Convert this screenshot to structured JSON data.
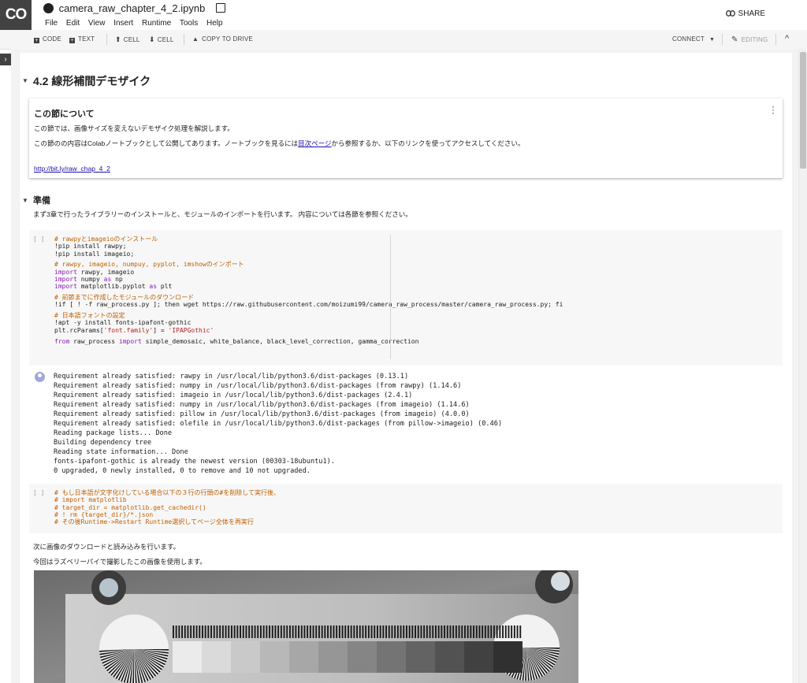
{
  "header": {
    "logo_text": "CO",
    "notebook_title": "camera_raw_chapter_4_2.ipynb",
    "menu": [
      "File",
      "Edit",
      "View",
      "Insert",
      "Runtime",
      "Tools",
      "Help"
    ],
    "share_label": "SHARE"
  },
  "toolbar": {
    "code_label": "CODE",
    "text_label": "TEXT",
    "cell_up_label": "CELL",
    "cell_down_label": "CELL",
    "copy_label": "COPY TO DRIVE",
    "connect_label": "CONNECT",
    "editing_label": "EDITING"
  },
  "section": {
    "heading": "4.2 線形補間デモザイク",
    "about": {
      "heading": "この節について",
      "p1": "この節では、画像サイズを変えないデモザイク処理を解説します。",
      "p2_before": "この節のの内容はColabノートブックとして公開してあります。ノートブックを見るには",
      "p2_link": "目次ページ",
      "p2_after": "から参照するか、以下のリンクを使ってアクセスしてください。",
      "url": "http://bit.ly/raw_chap_4_2"
    }
  },
  "prep": {
    "heading": "準備",
    "desc": "まず3章で行ったライブラリーのインストールと、モジュールのインポートを行います。 内容については各節を参照ください。"
  },
  "cell1": {
    "run_label": "[ ]",
    "lines": {
      "c1": "# rawpyとimageioのインストール",
      "l2": "!pip install rawpy;",
      "l3": "!pip install imageio;",
      "c4": "# rawpy, imageio, numpuy, pyplot, imshowのインポート",
      "l5_kw": "import",
      "l5_rest": " rawpy, imageio",
      "l6_kw": "import",
      "l6_mid": " numpy ",
      "l6_as": "as",
      "l6_rest": " np",
      "l7_kw": "import",
      "l7_mid": " matplotlib.pyplot ",
      "l7_as": "as",
      "l7_rest": " plt",
      "c8": "# 前節までに作成したモジュールのダウンロード",
      "l9": "!if [ ! -f raw_process.py ]; then wget https://raw.githubusercontent.com/moizumi99/camera_raw_process/master/camera_raw_process.py; fi",
      "c10": "# 日本語フォントの設定",
      "l11": "!apt -y install fonts-ipafont-gothic",
      "l12_a": "plt.rcParams[",
      "l12_s1": "'font.family'",
      "l12_b": "] = ",
      "l12_s2": "'IPAPGothic'",
      "l13_kw1": "from",
      "l13_mid": " raw_process ",
      "l13_kw2": "import",
      "l13_rest": " simple_demosaic, white_balance, black_level_correction, gamma_correction"
    }
  },
  "output": [
    "Requirement already satisfied: rawpy in /usr/local/lib/python3.6/dist-packages (0.13.1)",
    "Requirement already satisfied: numpy in /usr/local/lib/python3.6/dist-packages (from rawpy) (1.14.6)",
    "Requirement already satisfied: imageio in /usr/local/lib/python3.6/dist-packages (2.4.1)",
    "Requirement already satisfied: numpy in /usr/local/lib/python3.6/dist-packages (from imageio) (1.14.6)",
    "Requirement already satisfied: pillow in /usr/local/lib/python3.6/dist-packages (from imageio) (4.0.0)",
    "Requirement already satisfied: olefile in /usr/local/lib/python3.6/dist-packages (from pillow->imageio) (0.46)",
    "Reading package lists... Done",
    "Building dependency tree",
    "Reading state information... Done",
    "fonts-ipafont-gothic is already the newest version (00303-18ubuntu1).",
    "0 upgraded, 0 newly installed, 0 to remove and 10 not upgraded."
  ],
  "cell2": {
    "run_label": "[ ]",
    "lines": [
      "# もし日本語が文字化けしている場合以下の３行の行頭の#を削除して実行後、",
      "# import matplotlib",
      "# target_dir = matplotlib.get_cachedir()",
      "# ! rm {target_dir}/*.json",
      "# その後Runtime->Restart Runtime選択してページ全体を再実行"
    ]
  },
  "text_after": {
    "p1": "次に画像のダウンロードと読み込みを行います。",
    "p2": "今回はラズベリーパイで撮影したこの画像を使用します。"
  },
  "colors": {
    "comment": "#c16000",
    "keyword": "#8a1bb7",
    "string": "#b71c1c",
    "link": "#1a0dab",
    "logo_bg": "#424242"
  }
}
